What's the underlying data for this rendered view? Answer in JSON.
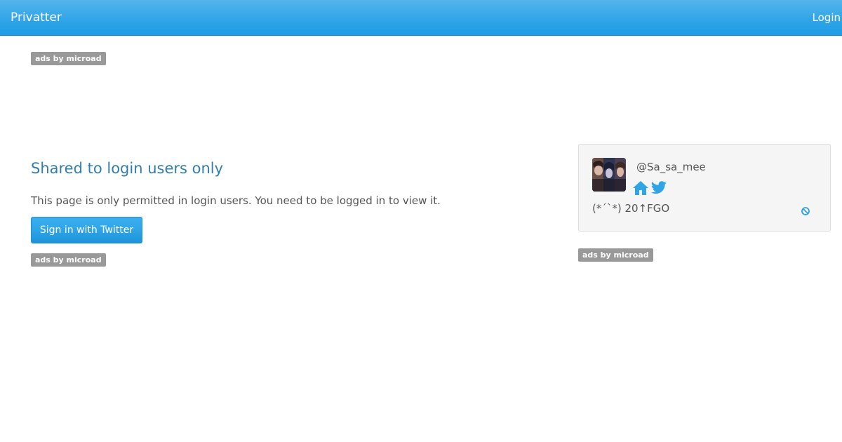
{
  "navbar": {
    "brand": "Privatter",
    "login_label": "Login"
  },
  "ads": {
    "top_label": "ads by microad",
    "main_label": "ads by microad",
    "side_label": "ads by microad"
  },
  "main": {
    "heading": "Shared to login users only",
    "message": "This page is only permitted in login users. You need to be logged in to view it.",
    "signin_button": "Sign in with Twitter"
  },
  "profile": {
    "username": "@Sa_sa_mee",
    "bio": "(*´`*) 20↑FGO",
    "icons": [
      "home-icon",
      "twitter-icon",
      "block-icon"
    ]
  },
  "colors": {
    "navbar": "#2fa4e7",
    "heading": "#317eac",
    "icon": "#2fa4e7",
    "ad_label_bg": "#999999",
    "card_bg": "#f5f5f5"
  }
}
